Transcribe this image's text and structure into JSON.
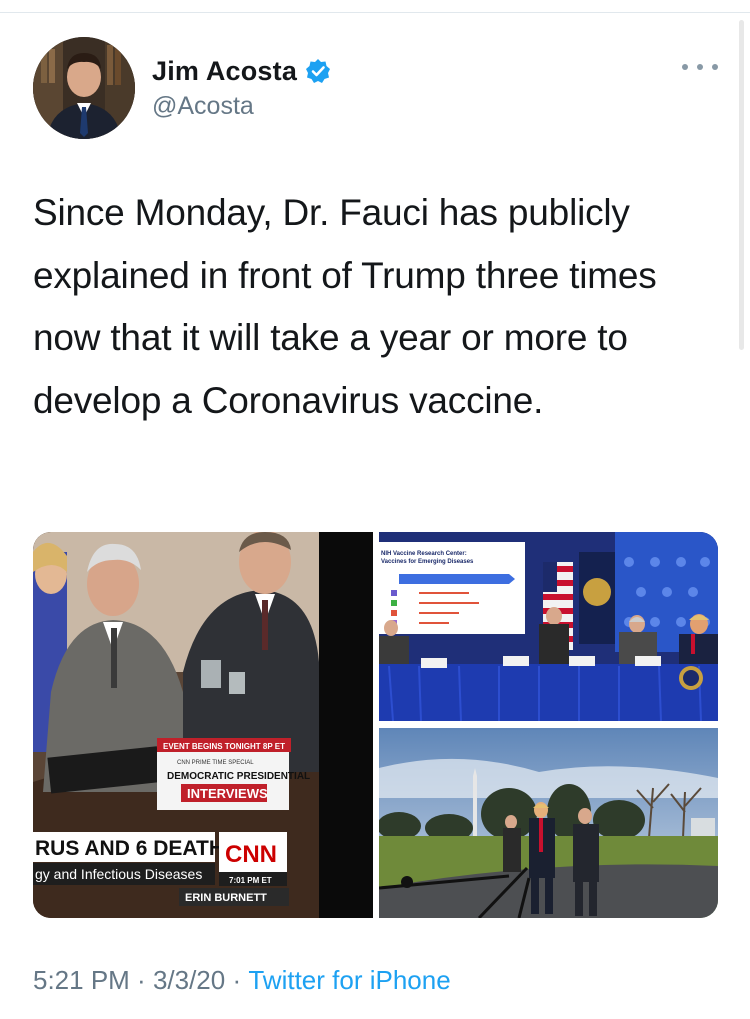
{
  "author": {
    "display_name": "Jim Acosta",
    "handle": "@Acosta",
    "verified": true,
    "verified_color": "#1da1f2"
  },
  "tweet": {
    "text": "Since Monday, Dr. Fauci has publicly explained in front of Trump three times now that it will take a year or more to develop a Coronavirus vaccine."
  },
  "media": {
    "left_image": {
      "banner_top": "EVENT BEGINS TONIGHT 8P ET",
      "banner_small": "CNN PRIME TIME SPECIAL",
      "banner_title": "DEMOCRATIC PRESIDENTIAL",
      "banner_sub": "INTERVIEWS",
      "lower_third": "RUS AND 6 DEATHS",
      "ticker": "gy and Infectious Diseases",
      "time": "7:01 PM ET",
      "show": "ERIN BURNETT",
      "network": "CNN"
    },
    "top_right_image": {
      "screen_title": "NIH Vaccine Research Center:",
      "screen_subtitle": "Vaccines for Emerging Diseases"
    }
  },
  "meta": {
    "time": "5:21 PM",
    "separator": " · ",
    "date": "3/3/20",
    "source": "Twitter for iPhone"
  },
  "icons": {
    "more": "more-horizontal-icon",
    "verified": "verified-badge-icon"
  }
}
